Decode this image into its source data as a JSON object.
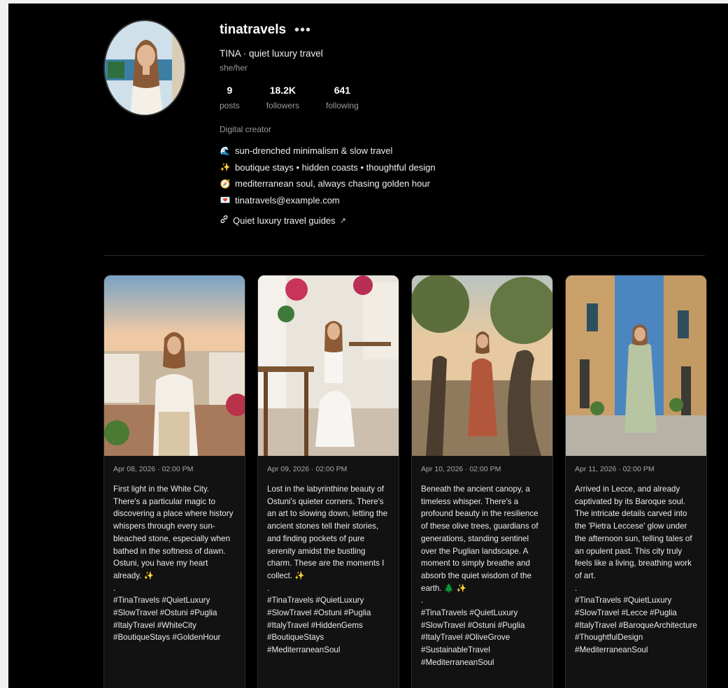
{
  "profile": {
    "username": "tinatravels",
    "more_label": "•••",
    "full_name": "TINA · quiet luxury travel",
    "pronouns": "she/her",
    "stats": [
      {
        "value": "9",
        "label": "posts"
      },
      {
        "value": "18.2K",
        "label": "followers"
      },
      {
        "value": "641",
        "label": "following"
      }
    ],
    "category": "Digital creator",
    "bio": [
      {
        "icon": "wave-icon",
        "glyph": "🌊",
        "text": "sun-drenched minimalism & slow travel"
      },
      {
        "icon": "sparkles-icon",
        "glyph": "✨",
        "text": "boutique stays • hidden coasts • thoughtful design"
      },
      {
        "icon": "compass-icon",
        "glyph": "🧭",
        "text": "mediterranean soul, always chasing golden hour"
      },
      {
        "icon": "envelope-heart-icon",
        "glyph": "💌",
        "text": "tinatravels@example.com"
      }
    ],
    "link": {
      "icon": "link-icon",
      "text": "Quiet luxury travel guides",
      "arrow": "↗"
    }
  },
  "posts": [
    {
      "date": "Apr 08, 2026 · 02:00 PM",
      "caption": "First light in the White City. There's a particular magic to discovering a place where history whispers through every sun-bleached stone, especially when bathed in the softness of dawn. Ostuni, you have my heart already. ✨\n.\n#TinaTravels #QuietLuxury #SlowTravel #Ostuni #Puglia #ItalyTravel #WhiteCity #BoutiqueStays #GoldenHour"
    },
    {
      "date": "Apr 09, 2026 · 02:00 PM",
      "caption": "Lost in the labyrinthine beauty of Ostuni's quieter corners. There's an art to slowing down, letting the ancient stones tell their stories, and finding pockets of pure serenity amidst the bustling charm. These are the moments I collect. ✨\n.\n#TinaTravels #QuietLuxury #SlowTravel #Ostuni #Puglia #ItalyTravel #HiddenGems #BoutiqueStays #MediterraneanSoul"
    },
    {
      "date": "Apr 10, 2026 · 02:00 PM",
      "caption": "Beneath the ancient canopy, a timeless whisper. There's a profound beauty in the resilience of these olive trees, guardians of generations, standing sentinel over the Puglian landscape. A moment to simply breathe and absorb the quiet wisdom of the earth. 🌲 ✨\n.\n#TinaTravels #QuietLuxury #SlowTravel #Ostuni #Puglia #ItalyTravel #OliveGrove #SustainableTravel #MediterraneanSoul"
    },
    {
      "date": "Apr 11, 2026 · 02:00 PM",
      "caption": "Arrived in Lecce, and already captivated by its Baroque soul. The intricate details carved into the 'Pietra Leccese' glow under the afternoon sun, telling tales of an opulent past. This city truly feels like a living, breathing work of art.\n.\n#TinaTravels #QuietLuxury #SlowTravel #Lecce #Puglia #ItalyTravel #BaroqueArchitecture #ThoughtfulDesign #MediterraneanSoul"
    }
  ]
}
